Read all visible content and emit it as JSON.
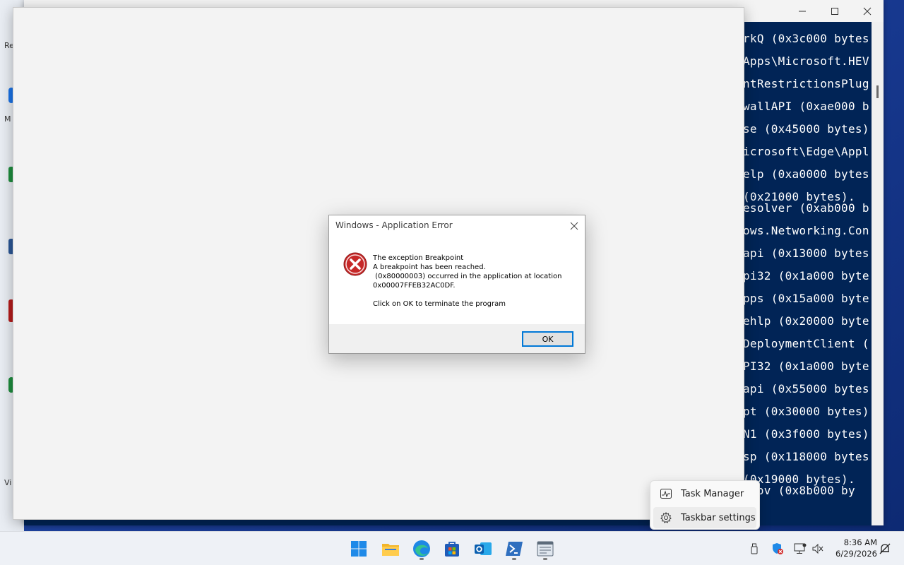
{
  "console": {
    "lines": [
      "rkQ (0x3c000 bytes",
      "Apps\\Microsoft.HEV",
      "ntRestrictionsPlug",
      "wallAPI (0xae000 b",
      "se (0x45000 bytes)",
      "icrosoft\\Edge\\Appl",
      "elp (0xa0000 bytes",
      "(0x21000 bytes).",
      "esolver (0xab000 b",
      "ows.Networking.Con",
      "api (0x13000 bytes",
      "pi32 (0x1a000 byte",
      "pps (0x15a000 byte",
      "ehlp (0x20000 byte",
      "DeploymentClient (",
      "PI32 (0x1a000 byte",
      "api (0x55000 bytes",
      "pt (0x30000 bytes)",
      "N1 (0x3f000 bytes)",
      "sp (0x118000 bytes",
      "(0x19000 bytes).",
      "prov (0x8b000 by"
    ],
    "colors": {
      "background": "#012456",
      "text": "#ffffff"
    }
  },
  "dialog": {
    "title": "Windows - Application Error",
    "message": "The exception Breakpoint\nA breakpoint has been reached.\n (0x80000003) occurred in the application at location\n0x00007FFEB32AC0DF.\n\nClick on OK to terminate the program",
    "ok_label": "OK",
    "icon": "error-icon",
    "accent": "#0078d7"
  },
  "context_menu": {
    "items": [
      {
        "label": "Task Manager",
        "icon": "task-manager-icon"
      },
      {
        "label": "Taskbar settings",
        "icon": "gear-icon"
      }
    ]
  },
  "taskbar": {
    "apps": [
      {
        "name": "start",
        "icon": "windows-logo-icon",
        "running": false
      },
      {
        "name": "file-explorer",
        "icon": "folder-icon",
        "running": false
      },
      {
        "name": "edge",
        "icon": "edge-icon",
        "running": true
      },
      {
        "name": "store",
        "icon": "store-icon",
        "running": false
      },
      {
        "name": "outlook",
        "icon": "outlook-icon",
        "running": false
      },
      {
        "name": "powershell",
        "icon": "powershell-icon",
        "running": true
      },
      {
        "name": "app-window",
        "icon": "window-app-icon",
        "running": true
      }
    ],
    "tray": [
      "usb-icon",
      "security-icon",
      "network-icon",
      "volume-icon"
    ],
    "time": "8:36 AM",
    "date": "6/29/2026"
  }
}
